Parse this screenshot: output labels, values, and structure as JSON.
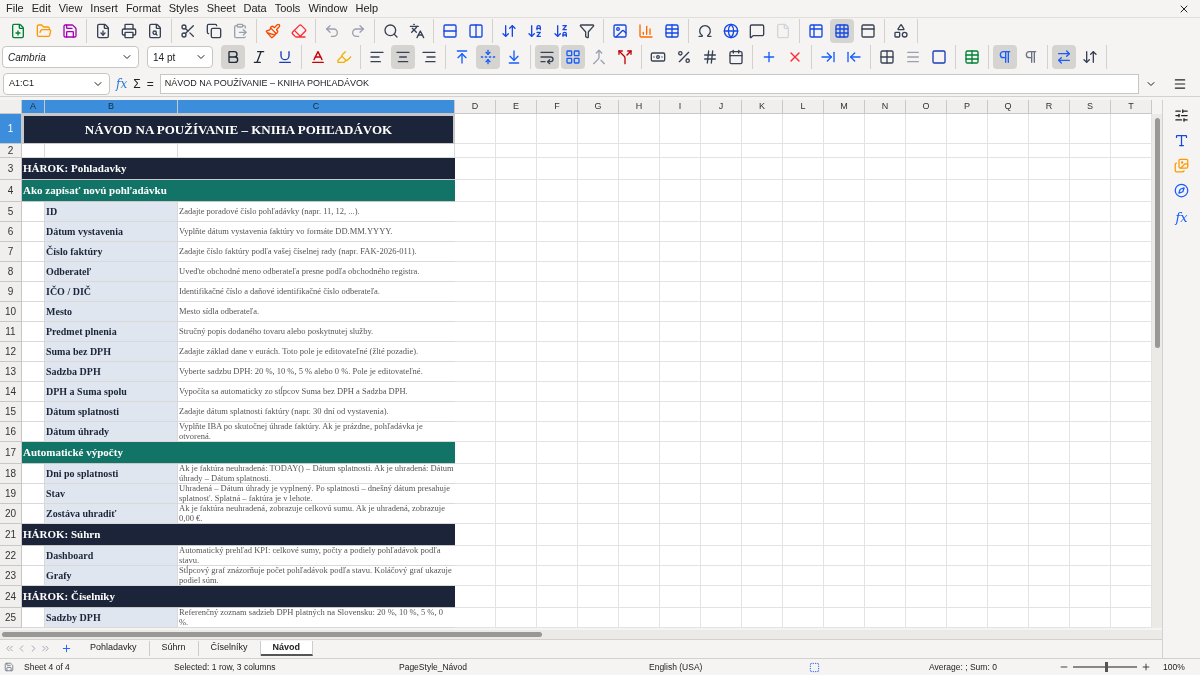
{
  "menu": [
    "File",
    "Edit",
    "View",
    "Insert",
    "Format",
    "Styles",
    "Sheet",
    "Data",
    "Tools",
    "Window",
    "Help"
  ],
  "standard_toolbar": [
    [
      {
        "kind": "new",
        "on": false
      },
      {
        "kind": "open",
        "on": false
      },
      {
        "kind": "save",
        "on": false
      }
    ],
    [
      {
        "kind": "pdf",
        "on": false
      },
      {
        "kind": "print",
        "on": false
      },
      {
        "kind": "preview",
        "on": false
      }
    ],
    [
      {
        "kind": "cut",
        "on": false
      },
      {
        "kind": "copy",
        "on": false
      },
      {
        "kind": "paste",
        "on": false
      }
    ],
    [
      {
        "kind": "clone",
        "on": false
      },
      {
        "kind": "clear",
        "on": false
      }
    ],
    [
      {
        "kind": "undo",
        "on": false
      },
      {
        "kind": "redo",
        "on": false
      }
    ],
    [
      {
        "kind": "find",
        "on": false
      },
      {
        "kind": "spelling",
        "on": false
      }
    ],
    [
      {
        "kind": "row",
        "on": false
      },
      {
        "kind": "column",
        "on": false
      }
    ],
    [
      {
        "kind": "sort",
        "on": false
      },
      {
        "kind": "sort_asc",
        "on": false
      },
      {
        "kind": "sort_desc",
        "on": false
      },
      {
        "kind": "filter",
        "on": false
      }
    ],
    [
      {
        "kind": "image",
        "on": false
      },
      {
        "kind": "chart",
        "on": false
      },
      {
        "kind": "pivot",
        "on": false
      }
    ],
    [
      {
        "kind": "special",
        "on": false
      },
      {
        "kind": "link",
        "on": false
      },
      {
        "kind": "comment",
        "on": false
      },
      {
        "kind": "header",
        "on": false
      }
    ],
    [
      {
        "kind": "define_print",
        "on": false
      },
      {
        "kind": "freeze",
        "on": true
      },
      {
        "kind": "split",
        "on": false
      }
    ],
    [
      {
        "kind": "shapes",
        "on": false
      }
    ]
  ],
  "font_name": "Cambria",
  "font_size": "14 pt",
  "format_toolbar": [
    [
      {
        "kind": "bold",
        "on": true
      },
      {
        "kind": "italic",
        "on": false
      },
      {
        "kind": "underline",
        "on": false
      }
    ],
    [
      {
        "kind": "font_color",
        "on": false
      },
      {
        "kind": "highlight",
        "on": false
      }
    ],
    [
      {
        "kind": "align_left",
        "on": false
      },
      {
        "kind": "align_center",
        "on": true
      },
      {
        "kind": "align_right",
        "on": false
      }
    ],
    [
      {
        "kind": "align_top",
        "on": false
      },
      {
        "kind": "align_middle",
        "on": true
      },
      {
        "kind": "align_bottom",
        "on": false
      }
    ],
    [
      {
        "kind": "wrap",
        "on": true
      },
      {
        "kind": "merge",
        "on": true
      },
      {
        "kind": "merge_off",
        "on": false
      },
      {
        "kind": "unmerge",
        "on": false
      }
    ],
    [
      {
        "kind": "currency",
        "on": false
      },
      {
        "kind": "percent",
        "on": false
      },
      {
        "kind": "number",
        "on": false
      },
      {
        "kind": "date",
        "on": false
      }
    ],
    [
      {
        "kind": "add_decimal",
        "on": false
      },
      {
        "kind": "del_decimal",
        "on": false
      }
    ],
    [
      {
        "kind": "indent_more",
        "on": false
      },
      {
        "kind": "indent_less",
        "on": false
      }
    ],
    [
      {
        "kind": "borders",
        "on": false
      },
      {
        "kind": "border_style",
        "on": false
      },
      {
        "kind": "border_color",
        "on": false
      }
    ],
    [
      {
        "kind": "conditional",
        "on": false
      }
    ],
    [
      {
        "kind": "ltr",
        "on": true
      },
      {
        "kind": "rtl",
        "on": false
      }
    ],
    [
      {
        "kind": "text_ltr",
        "on": true
      },
      {
        "kind": "text_ttb",
        "on": false
      }
    ]
  ],
  "formula_bar": {
    "name_box": "A1:C1",
    "function_wizard": "fx",
    "sum": "Σ",
    "equals": "=",
    "content": "NÁVOD NA POUŽÍVANIE – KNIHA POHĽADÁVOK"
  },
  "columns": [
    {
      "label": "A",
      "selected": true
    },
    {
      "label": "B",
      "selected": true
    },
    {
      "label": "C",
      "selected": true
    },
    {
      "label": "D",
      "selected": false
    },
    {
      "label": "E",
      "selected": false
    },
    {
      "label": "F",
      "selected": false
    },
    {
      "label": "G",
      "selected": false
    },
    {
      "label": "H",
      "selected": false
    },
    {
      "label": "I",
      "selected": false
    },
    {
      "label": "J",
      "selected": false
    },
    {
      "label": "K",
      "selected": false
    },
    {
      "label": "L",
      "selected": false
    },
    {
      "label": "M",
      "selected": false
    },
    {
      "label": "N",
      "selected": false
    },
    {
      "label": "O",
      "selected": false
    },
    {
      "label": "P",
      "selected": false
    },
    {
      "label": "Q",
      "selected": false
    },
    {
      "label": "R",
      "selected": false
    },
    {
      "label": "S",
      "selected": false
    },
    {
      "label": "T",
      "selected": false
    }
  ],
  "rows": [
    {
      "number": "1",
      "selected": true,
      "kind": "title",
      "label": "NÁVOD NA POUŽÍVANIE – KNIHA POHĽADÁVOK"
    },
    {
      "number": "2",
      "selected": false,
      "kind": "blank"
    },
    {
      "number": "3",
      "selected": false,
      "kind": "sheet",
      "label": "HÁROK: Pohladavky"
    },
    {
      "number": "4",
      "selected": false,
      "kind": "section",
      "label": "Ako zapísať novú pohľadávku"
    },
    {
      "number": "5",
      "selected": false,
      "kind": "item",
      "label": "ID",
      "description": "Zadajte poradové číslo pohľadávky (napr. 11, 12, ...)."
    },
    {
      "number": "6",
      "selected": false,
      "kind": "item",
      "label": "Dátum vystavenia",
      "description": "Vyplňte dátum vystavenia faktúry vo formáte DD.MM.YYYY."
    },
    {
      "number": "7",
      "selected": false,
      "kind": "item",
      "label": "Číslo faktúry",
      "description": "Zadajte číslo faktúry podľa vašej číselnej rady (napr. FAK-2026-011)."
    },
    {
      "number": "8",
      "selected": false,
      "kind": "item",
      "label": "Odberateľ",
      "description": "Uveďte obchodné meno odberateľa presne podľa obchodného registra."
    },
    {
      "number": "9",
      "selected": false,
      "kind": "item",
      "label": "IČO / DIČ",
      "description": "Identifikačné číslo a daňové identifikačné číslo odberateľa."
    },
    {
      "number": "10",
      "selected": false,
      "kind": "item",
      "label": "Mesto",
      "description": "Mesto sídla odberateľa."
    },
    {
      "number": "11",
      "selected": false,
      "kind": "item",
      "label": "Predmet plnenia",
      "description": "Stručný popis dodaného tovaru alebo poskytnutej služby."
    },
    {
      "number": "12",
      "selected": false,
      "kind": "item",
      "label": "Suma bez DPH",
      "description": "Zadajte základ dane v eurách. Toto pole je editovateľné (žlté pozadie)."
    },
    {
      "number": "13",
      "selected": false,
      "kind": "item",
      "label": "Sadzba DPH",
      "description": "Vyberte sadzbu DPH: 20 %, 10 %, 5 % alebo 0 %. Pole je editovateľné."
    },
    {
      "number": "14",
      "selected": false,
      "kind": "item",
      "label": "DPH a Suma spolu",
      "description": "Vypočíta sa automaticky zo stĺpcov Suma bez DPH a Sadzba DPH."
    },
    {
      "number": "15",
      "selected": false,
      "kind": "item",
      "label": "Dátum splatnosti",
      "description": "Zadajte dátum splatnosti faktúry (napr. 30 dní od vystavenia)."
    },
    {
      "number": "16",
      "selected": false,
      "kind": "item",
      "label": "Dátum úhrady",
      "description": "Vyplňte IBA po skutočnej úhrade faktúry. Ak je prázdne, pohľadávka je otvorená."
    },
    {
      "number": "17",
      "selected": false,
      "kind": "section",
      "label": "Automatické výpočty"
    },
    {
      "number": "18",
      "selected": false,
      "kind": "item",
      "label": "Dni po splatnosti",
      "description": "Ak je faktúra neuhradená: TODAY() – Dátum splatnosti. Ak je uhradená: Dátum úhrady – Dátum splatnosti."
    },
    {
      "number": "19",
      "selected": false,
      "kind": "item",
      "label": "Stav",
      "description": "Uhradená – Dátum úhrady je vyplnený. Po splatnosti – dnešný dátum presahuje splatnosť. Splatná – faktúra je v lehote."
    },
    {
      "number": "20",
      "selected": false,
      "kind": "item",
      "label": "Zostáva uhradiť",
      "description": "Ak je faktúra neuhradená, zobrazuje celkovú sumu. Ak je uhradená, zobrazuje 0,00 €."
    },
    {
      "number": "21",
      "selected": false,
      "kind": "sheet",
      "label": "HÁROK: Súhrn"
    },
    {
      "number": "22",
      "selected": false,
      "kind": "item",
      "label": "Dashboard",
      "description": "Automatický prehľad KPI: celkové sumy, počty a podiely pohľadávok podľa stavu."
    },
    {
      "number": "23",
      "selected": false,
      "kind": "item",
      "label": "Grafy",
      "description": "Stĺpcový graf znázorňuje počet pohľadávok podľa stavu. Koláčový graf ukazuje podiel súm."
    },
    {
      "number": "24",
      "selected": false,
      "kind": "sheet",
      "label": "HÁROK: Číselníky"
    },
    {
      "number": "25",
      "selected": false,
      "kind": "item",
      "label": "Sadzby DPH",
      "description": "Referenčný zoznam sadzieb DPH platných na Slovensku: 20 %, 10 %, 5 %, 0 %."
    }
  ],
  "sheet_tabs": [
    {
      "label": "Pohladavky",
      "selected": false
    },
    {
      "label": "Súhrn",
      "selected": false
    },
    {
      "label": "Číselníky",
      "selected": false
    },
    {
      "label": "Návod",
      "selected": true
    }
  ],
  "status_bar": {
    "sheet": "Sheet 4 of 4",
    "selection": "Selected: 1 row, 3 columns",
    "page_style": "PageStyle_Návod",
    "language": "English (USA)",
    "sum": "Average: ; Sum: 0",
    "zoom": {
      "level": 0.5,
      "label": "100%"
    }
  },
  "sidebar": {
    "functions_label": "fx"
  }
}
